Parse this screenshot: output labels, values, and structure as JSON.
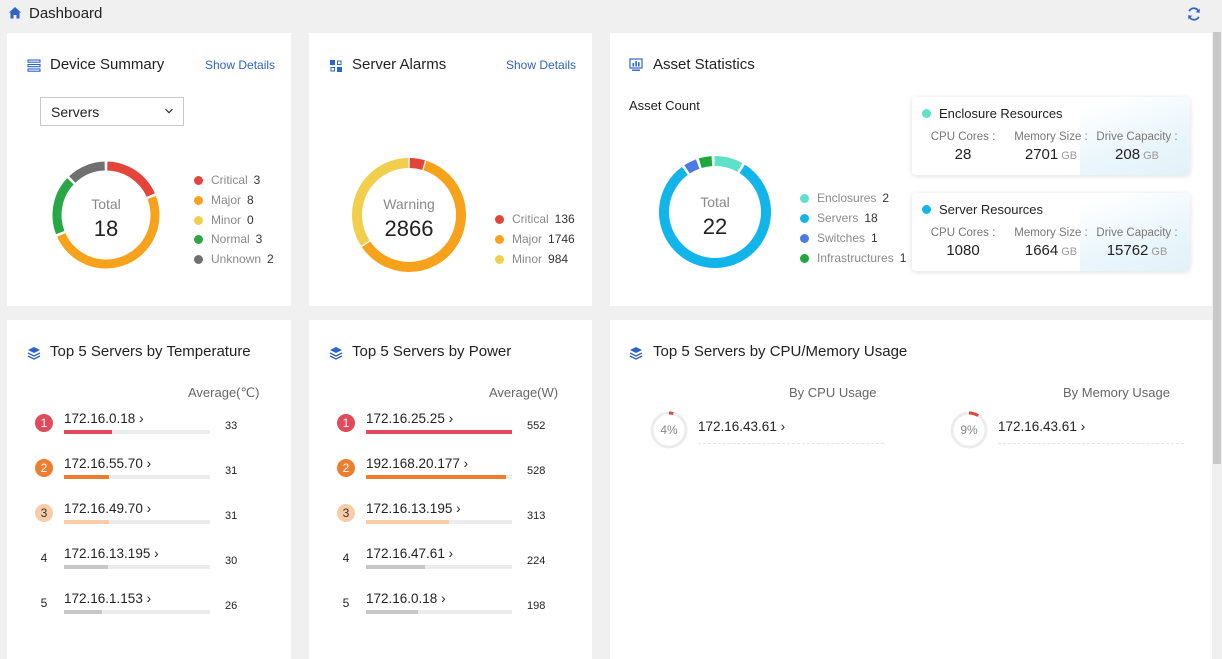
{
  "header": {
    "title": "Dashboard",
    "home_icon": "home-icon",
    "refresh_icon": "refresh-icon"
  },
  "colors": {
    "critical": "#e5443a",
    "major": "#f7a21b",
    "minor": "#f1cf4d",
    "normal": "#27a745",
    "unknown": "#707070",
    "enclosure": "#5ee1c9",
    "server": "#11b5ea",
    "switch": "#4b7be5",
    "infra": "#1ea83c",
    "rank1": "#e04a5a",
    "rank2": "#ee7d2e",
    "rank3": "#f8cca7",
    "rank_other": "#c7c7c7",
    "link": "#2f63c8"
  },
  "device_summary": {
    "title": "Device Summary",
    "show_details": "Show Details",
    "select_value": "Servers",
    "total_label": "Total",
    "total_value": "18",
    "legend": [
      {
        "label": "Critical",
        "value": "3",
        "color": "#e5443a"
      },
      {
        "label": "Major",
        "value": "8",
        "color": "#f7a21b"
      },
      {
        "label": "Minor",
        "value": "0",
        "color": "#f1cf4d"
      },
      {
        "label": "Normal",
        "value": "3",
        "color": "#27a745"
      },
      {
        "label": "Unknown",
        "value": "2",
        "color": "#707070"
      }
    ],
    "segments": [
      {
        "name": "Critical",
        "value": 3,
        "color": "#e5443a"
      },
      {
        "name": "Major",
        "value": 8,
        "color": "#f7a21b"
      },
      {
        "name": "Normal",
        "value": 3,
        "color": "#27a745"
      },
      {
        "name": "Unknown",
        "value": 2,
        "color": "#707070"
      }
    ]
  },
  "server_alarms": {
    "title": "Server Alarms",
    "show_details": "Show Details",
    "center_label": "Warning",
    "center_value": "2866",
    "legend": [
      {
        "label": "Critical",
        "value": "136",
        "color": "#e5443a"
      },
      {
        "label": "Major",
        "value": "1746",
        "color": "#f7a21b"
      },
      {
        "label": "Minor",
        "value": "984",
        "color": "#f1cf4d"
      }
    ],
    "segments": [
      {
        "name": "Critical",
        "value": 136,
        "color": "#e5443a"
      },
      {
        "name": "Major",
        "value": 1746,
        "color": "#f7a21b"
      },
      {
        "name": "Minor",
        "value": 984,
        "color": "#f1cf4d"
      }
    ]
  },
  "asset_statistics": {
    "title": "Asset Statistics",
    "asset_count_label": "Asset Count",
    "total_label": "Total",
    "total_value": "22",
    "legend": [
      {
        "label": "Enclosures",
        "value": "2",
        "color": "#5ee1c9"
      },
      {
        "label": "Servers",
        "value": "18",
        "color": "#11b5ea"
      },
      {
        "label": "Switches",
        "value": "1",
        "color": "#4b7be5"
      },
      {
        "label": "Infrastructures",
        "value": "1",
        "color": "#1ea83c"
      }
    ],
    "segments": [
      {
        "name": "Enclosures",
        "value": 2,
        "color": "#5ee1c9"
      },
      {
        "name": "Servers",
        "value": 18,
        "color": "#11b5ea"
      },
      {
        "name": "Switches",
        "value": 1,
        "color": "#4b7be5"
      },
      {
        "name": "Infrastructures",
        "value": 1,
        "color": "#1ea83c"
      }
    ],
    "enclosure_resources": {
      "title": "Enclosure Resources",
      "color": "#5ee1c9",
      "cpu_label": "CPU Cores  :",
      "cpu_value": "28",
      "mem_label": "Memory Size :",
      "mem_value": "2701",
      "mem_unit": "GB",
      "drive_label": "Drive Capacity :",
      "drive_value": "208",
      "drive_unit": "GB"
    },
    "server_resources": {
      "title": "Server Resources",
      "color": "#11b5ea",
      "cpu_label": "CPU Cores  :",
      "cpu_value": "1080",
      "mem_label": "Memory Size :",
      "mem_value": "1664",
      "mem_unit": "GB",
      "drive_label": "Drive Capacity :",
      "drive_value": "15762",
      "drive_unit": "GB"
    }
  },
  "top_temperature": {
    "title": "Top 5 Servers by Temperature",
    "average_label": "Average(℃)",
    "max": 33,
    "items": [
      {
        "rank": "1",
        "ip": "172.16.0.18 ›",
        "value": "33",
        "num": 33
      },
      {
        "rank": "2",
        "ip": "172.16.55.70 ›",
        "value": "31",
        "num": 31
      },
      {
        "rank": "3",
        "ip": "172.16.49.70 ›",
        "value": "31",
        "num": 31
      },
      {
        "rank": "4",
        "ip": "172.16.13.195 ›",
        "value": "30",
        "num": 30
      },
      {
        "rank": "5",
        "ip": "172.16.1.153 ›",
        "value": "26",
        "num": 26
      }
    ]
  },
  "top_power": {
    "title": "Top 5 Servers by Power",
    "average_label": "Average(W)",
    "max": 552,
    "items": [
      {
        "rank": "1",
        "ip": "172.16.25.25 ›",
        "value": "552",
        "num": 552
      },
      {
        "rank": "2",
        "ip": "192.168.20.177 ›",
        "value": "528",
        "num": 528
      },
      {
        "rank": "3",
        "ip": "172.16.13.195 ›",
        "value": "313",
        "num": 313
      },
      {
        "rank": "4",
        "ip": "172.16.47.61 ›",
        "value": "224",
        "num": 224
      },
      {
        "rank": "5",
        "ip": "172.16.0.18 ›",
        "value": "198",
        "num": 198
      }
    ]
  },
  "top_usage": {
    "title": "Top 5 Servers by CPU/Memory Usage",
    "cpu_heading": "By CPU Usage",
    "mem_heading": "By Memory Usage",
    "cpu_items": [
      {
        "ip": "172.16.43.61 ›",
        "percent": "4%",
        "fraction": 0.04
      }
    ],
    "mem_items": [
      {
        "ip": "172.16.43.61 ›",
        "percent": "9%",
        "fraction": 0.09
      }
    ]
  }
}
